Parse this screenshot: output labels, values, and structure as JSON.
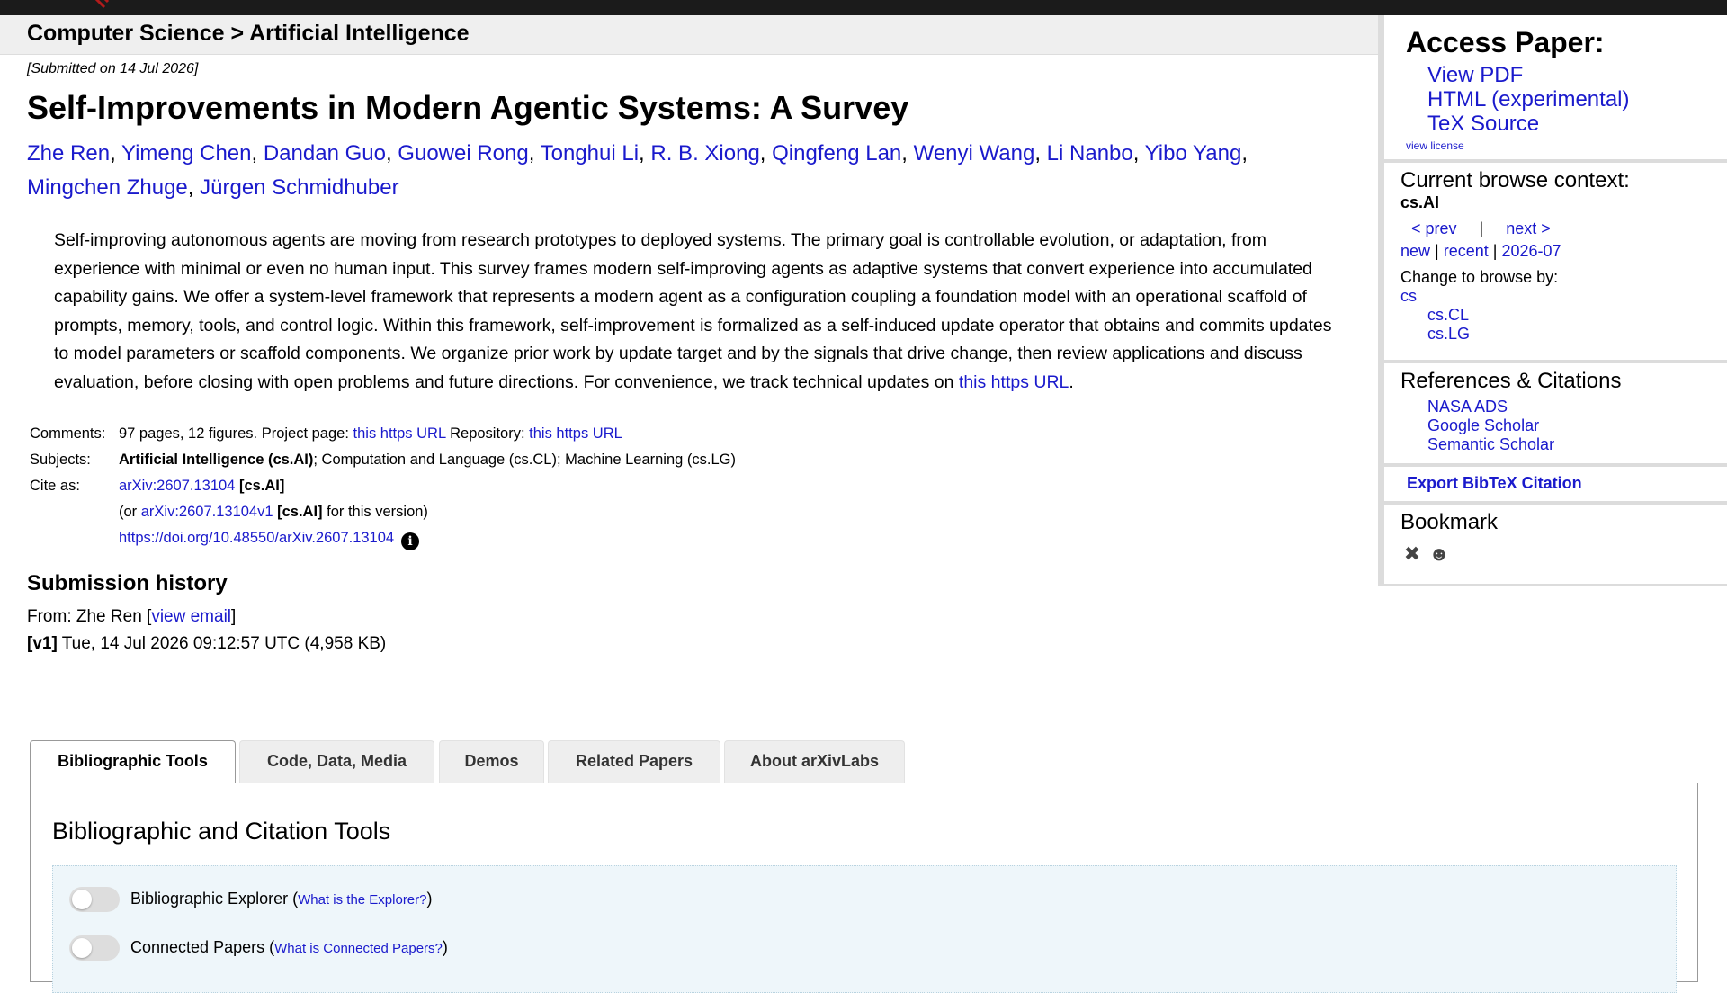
{
  "breadcrumb": "Computer Science > Artificial Intelligence",
  "submitted": "[Submitted on 14 Jul 2026]",
  "title": "Self-Improvements in Modern Agentic Systems: A Survey",
  "authors": [
    "Zhe Ren",
    "Yimeng Chen",
    "Dandan Guo",
    "Guowei Rong",
    "Tonghui Li",
    "R. B. Xiong",
    "Qingfeng Lan",
    "Wenyi Wang",
    "Li Nanbo",
    "Yibo Yang",
    "Mingchen Zhuge",
    "Jürgen Schmidhuber"
  ],
  "abstract": {
    "text": "Self-improving autonomous agents are moving from research prototypes to deployed systems. The primary goal is controllable evolution, or adaptation, from experience with minimal or even no human input. This survey frames modern self-improving agents as adaptive systems that convert experience into accumulated capability gains. We offer a system-level framework that represents a modern agent as a configuration coupling a foundation model with an operational scaffold of prompts, memory, tools, and control logic. Within this framework, self-improvement is formalized as a self-induced update operator that obtains and commits updates to model parameters or scaffold components. We organize prior work by update target and by the signals that drive change, then review applications and discuss evaluation, before closing with open problems and future directions. For convenience, we track technical updates on ",
    "link": "this https URL",
    "tail": "."
  },
  "meta": {
    "comments_label": "Comments:",
    "comments_text1": "97 pages, 12 figures. Project page: ",
    "comments_link1": "this https URL",
    "comments_text2": " Repository: ",
    "comments_link2": "this https URL",
    "subjects_label": "Subjects:",
    "subjects_primary": "Artificial Intelligence (cs.AI)",
    "subjects_rest": "; Computation and Language (cs.CL); Machine Learning (cs.LG)",
    "cite_label": "Cite as:",
    "cite_id": "arXiv:2607.13104",
    "cite_cat": " [cs.AI]",
    "cite_or": "(or ",
    "cite_v1": "arXiv:2607.13104v1",
    "cite_v1_cat": " [cs.AI]",
    "cite_v1_tail": " for this version)",
    "doi": "https://doi.org/10.48550/arXiv.2607.13104",
    "info_glyph": "i"
  },
  "history": {
    "heading": "Submission history",
    "from_prefix": "From: Zhe Ren [",
    "from_link": "view email",
    "from_suffix": "]",
    "version": "[v1]",
    "version_text": " Tue, 14 Jul 2026 09:12:57 UTC (4,958 KB)"
  },
  "sidebar": {
    "access_heading": "Access Paper:",
    "access_links": [
      "View PDF",
      "HTML (experimental)",
      "TeX Source"
    ],
    "view_license": "view license",
    "context_heading": "Current browse context:",
    "context_value": "cs.AI",
    "prev": "< prev",
    "nav_sep": "|",
    "next": "next >",
    "new": "new",
    "recent": "recent",
    "month": "2026-07",
    "change_label": "Change to browse by:",
    "cats_top": "cs",
    "cats_sub": [
      "cs.CL",
      "cs.LG"
    ],
    "refs_heading": "References & Citations",
    "refs_links": [
      "NASA ADS",
      "Google Scholar",
      "Semantic Scholar"
    ],
    "export_bibtex": "Export BibTeX Citation",
    "bookmark_heading": "Bookmark"
  },
  "tabs": [
    "Bibliographic Tools",
    "Code, Data, Media",
    "Demos",
    "Related Papers",
    "About arXivLabs"
  ],
  "panel": {
    "heading": "Bibliographic and Citation Tools",
    "tools": [
      {
        "name": "Bibliographic Explorer",
        "link": "What is the Explorer?"
      },
      {
        "name": "Connected Papers",
        "link": "What is Connected Papers?"
      }
    ]
  },
  "colors": {
    "link": "#1a1acc",
    "topbar": "#1b1b1b",
    "accent_logo": "#b31b1b"
  }
}
